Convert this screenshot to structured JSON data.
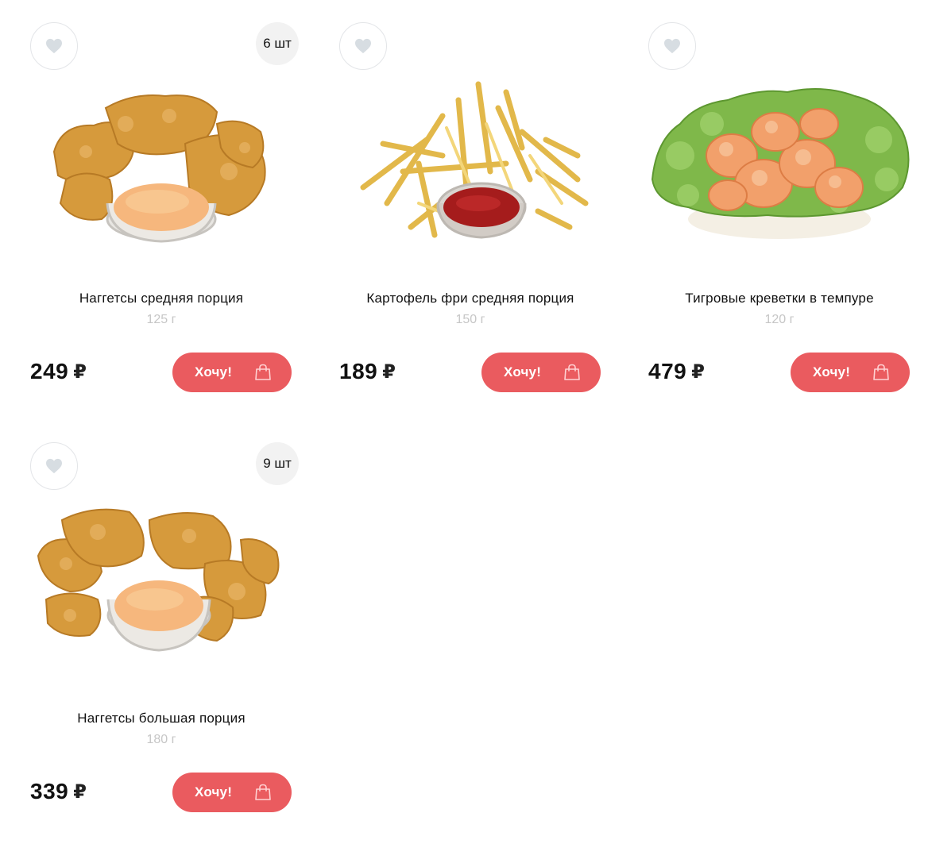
{
  "products": [
    {
      "name": "Наггетсы средняя порция",
      "weight": "125 г",
      "price": "249",
      "currency": "₽",
      "count_badge": "6 шт",
      "button_label": "Хочу!",
      "image": "nuggets-with-sauce"
    },
    {
      "name": "Картофель фри средняя порция",
      "weight": "150 г",
      "price": "189",
      "currency": "₽",
      "count_badge": "",
      "button_label": "Хочу!",
      "image": "french-fries-with-ketchup"
    },
    {
      "name": "Тигровые креветки в темпуре",
      "weight": "120 г",
      "price": "479",
      "currency": "₽",
      "count_badge": "",
      "button_label": "Хочу!",
      "image": "tempura-shrimp-on-lettuce"
    },
    {
      "name": "Наггетсы большая порция",
      "weight": "180 г",
      "price": "339",
      "currency": "₽",
      "count_badge": "9 шт",
      "button_label": "Хочу!",
      "image": "nuggets-large-with-sauce"
    }
  ],
  "colors": {
    "accent": "#ea5b5f",
    "heart": "#d7dde2",
    "muted_text": "#c6c6c6",
    "badge_bg": "#f2f2f2"
  },
  "icons": {
    "favorite": "heart-icon",
    "cart": "shopping-bag-icon"
  }
}
